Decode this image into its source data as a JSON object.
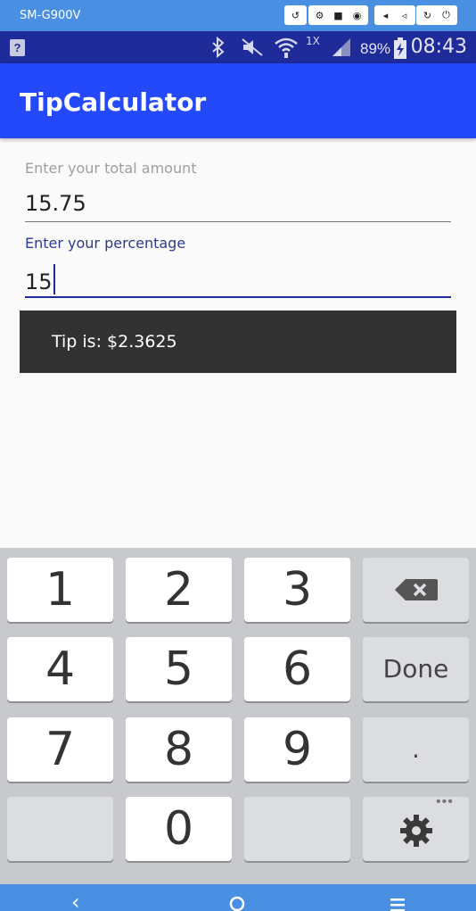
{
  "emulator": {
    "device_name": "SM-G900V"
  },
  "status_bar": {
    "network_label": "1X",
    "battery_percent": "89%",
    "time": "08:43"
  },
  "app_bar": {
    "title": "TipCalculator"
  },
  "form": {
    "total_label": "Enter your total amount",
    "total_value": "15.75",
    "percentage_label": "Enter your percentage",
    "percentage_value": "15"
  },
  "toast": {
    "message": "Tip is: $2.3625"
  },
  "keyboard": {
    "keys": [
      "1",
      "2",
      "3",
      "4",
      "5",
      "6",
      "7",
      "8",
      "9",
      "0"
    ],
    "done_label": "Done",
    "dot_label": ".",
    "more_label": "•••"
  },
  "colors": {
    "app_bar": "#2449fb",
    "status_bar": "#1f2b99",
    "accent": "#1f2b99",
    "toast_bg": "#323232",
    "keyboard_bg": "#c8c9cc",
    "emulator_frame": "#4a90e2"
  },
  "icons": {
    "emulator": [
      "rotate-icon",
      "settings-icon",
      "video-icon",
      "camera-icon",
      "volume-down-icon",
      "volume-up-icon",
      "refresh-icon",
      "power-icon"
    ],
    "status": [
      "unknown-app-icon",
      "bluetooth-icon",
      "mute-icon",
      "wifi-icon",
      "signal-icon",
      "battery-charging-icon"
    ],
    "keyboard": [
      "backspace-icon",
      "settings-icon"
    ],
    "nav": [
      "back-icon",
      "home-icon",
      "menu-icon"
    ]
  }
}
